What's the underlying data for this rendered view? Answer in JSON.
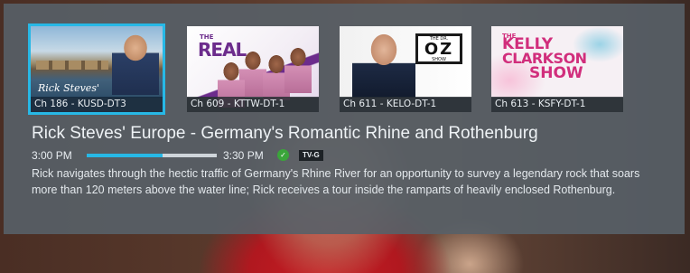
{
  "channels": [
    {
      "caption": "Ch 186 - KUSD-DT3",
      "art_text": "Rick Steves'",
      "selected": true
    },
    {
      "caption": "Ch 609 - KTTW-DT-1",
      "art_text": "REAL",
      "art_small": "THE",
      "selected": false
    },
    {
      "caption": "Ch 611 - KELO-DT-1",
      "art_text": "OZ",
      "art_small": "THE DR.",
      "art_sub": "SHOW",
      "selected": false
    },
    {
      "caption": "Ch 613 - KSFY-DT-1",
      "art_small": "THE",
      "art_lines": [
        "KELLY",
        "CLARKSON",
        "SHOW"
      ],
      "selected": false
    }
  ],
  "program": {
    "title": "Rick Steves' Europe - Germany's Romantic Rhine and Rothenburg",
    "start_time": "3:00 PM",
    "end_time": "3:30 PM",
    "progress": 0.58,
    "rating": "TV-G",
    "description": "Rick navigates through the hectic traffic of Germany's Rhine River for an opportunity to survey a legendary rock that soars more than 120 meters above the water line; Rick receives a tour inside the ramparts of heavily enclosed Rothenburg."
  },
  "colors": {
    "accent": "#27b8e6",
    "overlay": "#586068",
    "cc_icon": "#3aa53a"
  },
  "icons": {
    "closed_caption": "cc-icon"
  }
}
